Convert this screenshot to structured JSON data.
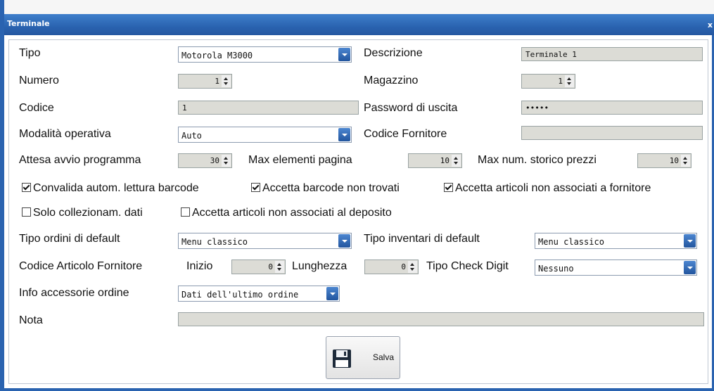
{
  "window": {
    "title": "Terminale",
    "close_label": "x"
  },
  "form": {
    "tipo": {
      "label": "Tipo",
      "value": "Motorola M3000"
    },
    "descrizione": {
      "label": "Descrizione",
      "value": "Terminale 1"
    },
    "numero": {
      "label": "Numero",
      "value": "1"
    },
    "magazzino": {
      "label": "Magazzino",
      "value": "1"
    },
    "codice": {
      "label": "Codice",
      "value": "1"
    },
    "password": {
      "label": "Password di uscita",
      "value": "•••••"
    },
    "modalita": {
      "label": "Modalità operativa",
      "value": "Auto"
    },
    "codice_fornitore": {
      "label": "Codice Fornitore",
      "value": ""
    },
    "attesa": {
      "label": "Attesa avvio programma",
      "value": "30"
    },
    "max_elementi": {
      "label": "Max elementi pagina",
      "value": "10"
    },
    "max_storico": {
      "label": "Max num. storico prezzi",
      "value": "10"
    },
    "checkboxes": [
      {
        "label": "Convalida autom. lettura barcode",
        "checked": true
      },
      {
        "label": "Accetta barcode non trovati",
        "checked": true
      },
      {
        "label": "Accetta articoli non associati a fornitore",
        "checked": true
      },
      {
        "label": "Solo collezionam. dati",
        "checked": false
      },
      {
        "label": "Accetta articoli non associati al deposito",
        "checked": false
      }
    ],
    "tipo_ordini": {
      "label": "Tipo ordini di default",
      "value": "Menu classico"
    },
    "tipo_inventari": {
      "label": "Tipo inventari di default",
      "value": "Menu classico"
    },
    "codice_articolo": {
      "label": "Codice Articolo Fornitore"
    },
    "inizio": {
      "label": "Inizio",
      "value": "0"
    },
    "lunghezza": {
      "label": "Lunghezza",
      "value": "0"
    },
    "check_digit": {
      "label": "Tipo Check Digit",
      "value": "Nessuno"
    },
    "info_accessorie": {
      "label": "Info accessorie ordine",
      "value": "Dati dell'ultimo ordine"
    },
    "nota": {
      "label": "Nota",
      "value": ""
    }
  },
  "save_button": {
    "label": "Salva",
    "icon": "floppy-disk-icon"
  },
  "colors": {
    "titlebar": "#2a63b0",
    "dropdown_arrow": "#22559e",
    "readonly_field": "#dcdcd6"
  }
}
